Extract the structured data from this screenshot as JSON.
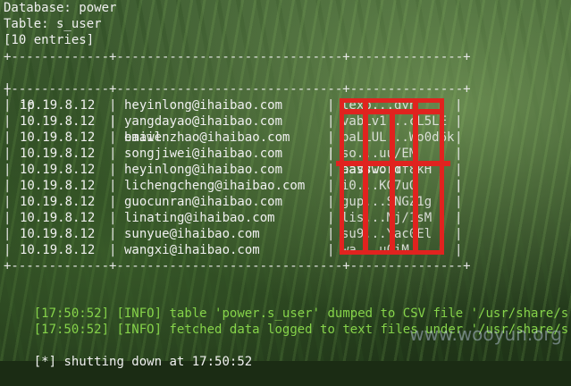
{
  "header": {
    "database_line": "Database: power",
    "table_line": "Table: s_user",
    "entries_line": "[10 entries]"
  },
  "table": {
    "columns": [
      "ip",
      "email",
      "password"
    ],
    "rows": [
      {
        "ip": "10.19.8.12",
        "email": "heyinlong@ihaibao.com",
        "password": "lexp...gyn"
      },
      {
        "ip": "10.19.8.12",
        "email": "yangdayao@ihaibao.com",
        "password": "vabLv1...cL5LE"
      },
      {
        "ip": "10.19.8.12",
        "email": "baiwenzhao@ihaibao.com",
        "password": "baLLUL...Wo0d6k"
      },
      {
        "ip": "10.19.8.12",
        "email": "songjiwei@ihaibao.com",
        "password": "so...uu/EM"
      },
      {
        "ip": "10.19.8.12",
        "email": "heyinlong@ihaibao.com",
        "password": "aaVV...Tf8kH"
      },
      {
        "ip": "10.19.8.12",
        "email": "lichengcheng@ihaibao.com",
        "password": "i0...KG7uQ"
      },
      {
        "ip": "10.19.8.12",
        "email": "guocunran@ihaibao.com",
        "password": "gup...SNGZ1g"
      },
      {
        "ip": "10.19.8.12",
        "email": "linating@ihaibao.com",
        "password": "lis...Mj/1sM"
      },
      {
        "ip": "10.19.8.12",
        "email": "sunyue@ihaibao.com",
        "password": "su9...Yac0El"
      },
      {
        "ip": "10.19.8.12",
        "email": "wangxi@ihaibao.com",
        "password": "wa...u0iM"
      }
    ]
  },
  "log": [
    {
      "time": "[17:50:52]",
      "level": "[INFO]",
      "message": "table 'power.s_user' dumped to CSV file '/usr/share/s"
    },
    {
      "time": "[17:50:52]",
      "level": "[INFO]",
      "message": "fetched data logged to text files under '/usr/share/s"
    }
  ],
  "footer": {
    "marker": "[*]",
    "text": "shutting down at 17:50:52"
  },
  "watermark": "www.wooyun.org",
  "colors": {
    "text": "#f0f0f0",
    "log_green": "#86d34a",
    "redaction_red": "#e0231f"
  }
}
